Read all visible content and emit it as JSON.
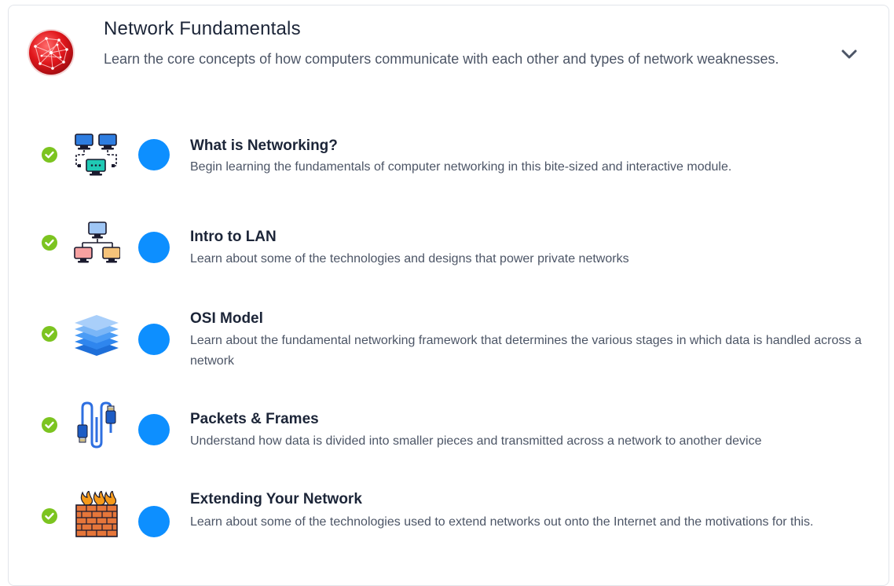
{
  "module": {
    "title": "Network Fundamentals",
    "description": "Learn the core concepts of how computers communicate with each other and types of network weaknesses.",
    "icon": "network-globe-icon",
    "expand_icon": "chevron-down-icon"
  },
  "rooms": [
    {
      "title": "What is Networking?",
      "description": "Begin learning the fundamentals of computer networking in this bite-sized and interactive module.",
      "icon": "networked-computers-icon",
      "completed": true
    },
    {
      "title": "Intro to LAN",
      "description": "Learn about some of the technologies and designs that power private networks",
      "icon": "lan-topology-icon",
      "completed": true
    },
    {
      "title": "OSI Model",
      "description": "Learn about the fundamental networking framework that determines the various stages in which data is handled across a network",
      "icon": "layers-icon",
      "completed": true
    },
    {
      "title": "Packets & Frames",
      "description": "Understand how data is divided into smaller pieces and transmitted across a network to another device",
      "icon": "ethernet-cable-icon",
      "completed": true
    },
    {
      "title": "Extending Your Network",
      "description": "Learn about some of the technologies used to extend networks out onto the Internet and the motivations for this.",
      "icon": "firewall-icon",
      "completed": true
    }
  ],
  "colors": {
    "check": "#7cc420",
    "dot": "#0d8fff",
    "title": "#1c2538",
    "text": "#4c5566"
  }
}
